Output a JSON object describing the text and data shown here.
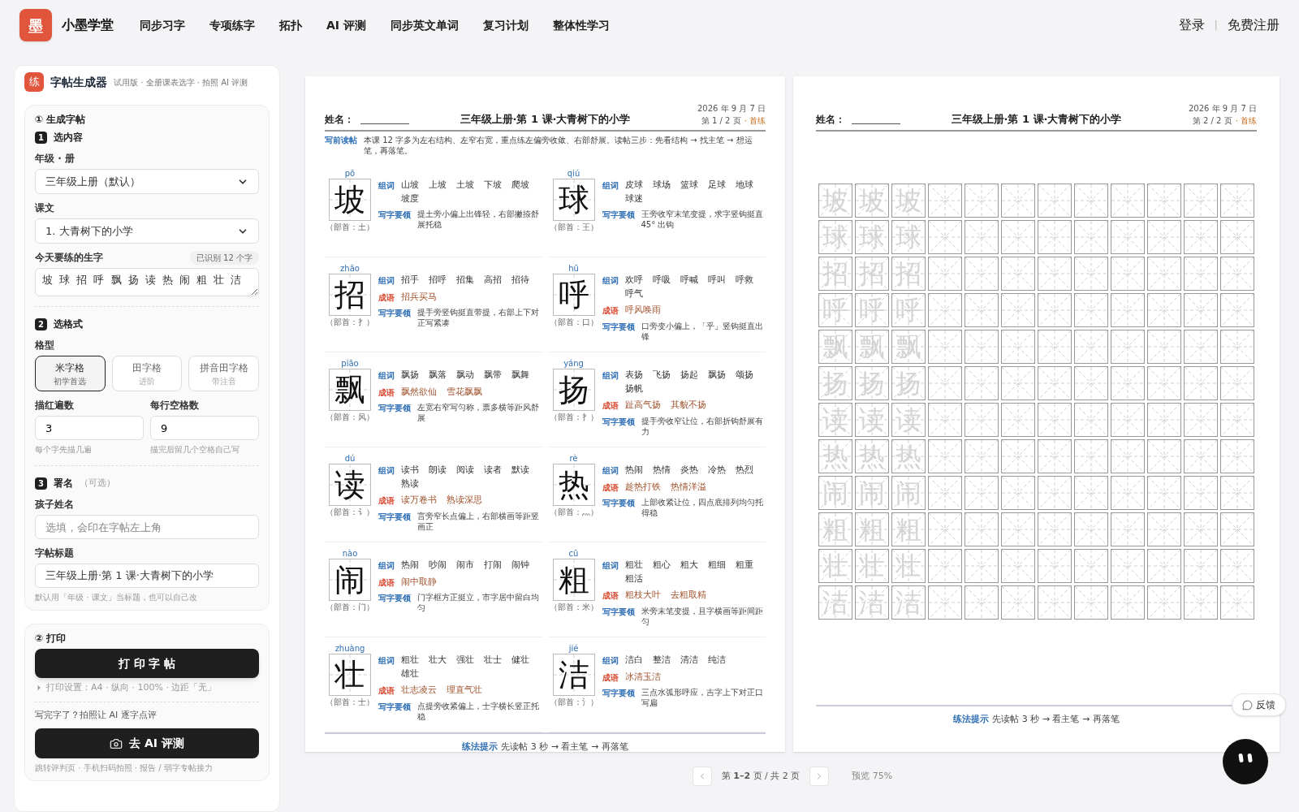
{
  "header": {
    "logo": "墨",
    "brand": "小墨学堂",
    "nav": [
      "同步习字",
      "专项练字",
      "拓扑",
      "AI 评测",
      "同步英文单词",
      "复习计划",
      "整体性学习"
    ],
    "login": "登录",
    "separator": "|",
    "register": "免费注册"
  },
  "sidebar": {
    "logo": "练",
    "title": "字帖生成器",
    "subtitle": "试用版 · 全册课表选字 · 拍照 AI 评测",
    "generate": {
      "heading": "① 生成字帖",
      "step1": {
        "number": "1",
        "title": "选内容",
        "grade_label": "年级 · 册",
        "grade_value": "三年级上册（默认）",
        "lesson_label": "课文",
        "lesson_value": "1. 大青树下的小学",
        "chars_label": "今天要练的生字",
        "chars_count": "已识别 12 个字",
        "chars_value": "坡 球 招 呼 飘 扬 读 热 闹 粗 壮 洁"
      },
      "step2": {
        "number": "2",
        "title": "选格式",
        "type_label": "格型",
        "types": [
          {
            "name": "米字格",
            "hint": "初学首选",
            "selected": true
          },
          {
            "name": "田字格",
            "hint": "进阶",
            "selected": false
          },
          {
            "name": "拼音田字格",
            "hint": "带注音",
            "selected": false
          }
        ],
        "trace_label": "描红遍数",
        "trace_value": "3",
        "trace_hint": "每个字先描几遍",
        "blank_label": "每行空格数",
        "blank_value": "9",
        "blank_hint": "描完后留几个空格自己写"
      },
      "step3": {
        "number": "3",
        "title": "署名",
        "optional": "（可选）",
        "name_label": "孩子姓名",
        "name_placeholder": "选填，会印在字帖左上角",
        "title_label": "字帖标题",
        "title_value": "三年级上册·第 1 课·大青树下的小学",
        "title_hint": "默认用「年级 · 课文」当标题，也可以自己改"
      }
    },
    "print": {
      "heading": "② 打印",
      "print_button": "打 印 字 帖",
      "settings": "打印设置：A4 · 纵向 · 100% · 边距「无」",
      "ai_prompt": "写完字了？拍照让 AI 逐字点评",
      "ai_button": "去 AI 评测",
      "ai_hint": "跳转评判页 · 手机扫码拍照 · 报告 / 弱字专帖接力"
    }
  },
  "pages": [
    {
      "name_label": "姓名：",
      "title": "三年级上册·第 1 课·大青树下的小学",
      "date": "2026 年 9 月 7 日",
      "page_no": "第 1 / 2 页",
      "mark": "· 首练",
      "intro_label": "写前读帖",
      "intro": "本课 12 字多为左右结构、左窄右宽，重点练左偏旁收敛、右部舒展。读帖三步：先看结构 → 找主笔 → 想运笔，再落笔。",
      "entries": [
        {
          "pinyin": "pō",
          "char": "坡",
          "radical": "（部首：土）",
          "lines": [
            {
              "kind": "words",
              "label": "组词",
              "items": [
                "山坡",
                "上坡",
                "土坡",
                "下坡",
                "爬坡",
                "坡度"
              ]
            },
            {
              "kind": "tip",
              "label": "写字要领",
              "text": "提土旁小偏上出锋轻，右部撇捺舒展托稳"
            }
          ]
        },
        {
          "pinyin": "qiú",
          "char": "球",
          "radical": "（部首：王）",
          "lines": [
            {
              "kind": "words",
              "label": "组词",
              "items": [
                "皮球",
                "球场",
                "篮球",
                "足球",
                "地球",
                "球迷"
              ]
            },
            {
              "kind": "tip",
              "label": "写字要领",
              "text": "王旁收窄末笔变提，求字竖钩挺直 45° 出钩"
            }
          ]
        },
        {
          "pinyin": "zhāo",
          "char": "招",
          "radical": "（部首：扌）",
          "lines": [
            {
              "kind": "words",
              "label": "组词",
              "items": [
                "招手",
                "招呼",
                "招集",
                "高招",
                "招待"
              ]
            },
            {
              "kind": "idioms",
              "label": "成语",
              "items": [
                "招兵买马"
              ]
            },
            {
              "kind": "tip",
              "label": "写字要领",
              "text": "提手旁竖钩挺直带提，右部上下对正写紧凑"
            }
          ]
        },
        {
          "pinyin": "hū",
          "char": "呼",
          "radical": "（部首：口）",
          "lines": [
            {
              "kind": "words",
              "label": "组词",
              "items": [
                "欢呼",
                "呼吸",
                "呼喊",
                "呼叫",
                "呼救",
                "呼气"
              ]
            },
            {
              "kind": "idioms",
              "label": "成语",
              "items": [
                "呼风唤雨"
              ]
            },
            {
              "kind": "tip",
              "label": "写字要领",
              "text": "口旁变小偏上，「乎」竖钩挺直出锋"
            }
          ]
        },
        {
          "pinyin": "piāo",
          "char": "飘",
          "radical": "（部首：风）",
          "lines": [
            {
              "kind": "words",
              "label": "组词",
              "items": [
                "飘扬",
                "飘落",
                "飘动",
                "飘带",
                "飘舞"
              ]
            },
            {
              "kind": "idioms",
              "label": "成语",
              "items": [
                "飘然欲仙",
                "雪花飘飘"
              ]
            },
            {
              "kind": "tip",
              "label": "写字要领",
              "text": "左宽右窄写匀称，票多横等距风舒展"
            }
          ]
        },
        {
          "pinyin": "yáng",
          "char": "扬",
          "radical": "（部首：扌）",
          "lines": [
            {
              "kind": "words",
              "label": "组词",
              "items": [
                "表扬",
                "飞扬",
                "扬起",
                "飘扬",
                "颂扬",
                "扬帆"
              ]
            },
            {
              "kind": "idioms",
              "label": "成语",
              "items": [
                "趾高气扬",
                "其貌不扬"
              ]
            },
            {
              "kind": "tip",
              "label": "写字要领",
              "text": "提手旁收窄让位，右部折钩舒展有力"
            }
          ]
        },
        {
          "pinyin": "dú",
          "char": "读",
          "radical": "（部首：讠）",
          "lines": [
            {
              "kind": "words",
              "label": "组词",
              "items": [
                "读书",
                "朗读",
                "阅读",
                "读者",
                "默读",
                "熟读"
              ]
            },
            {
              "kind": "idioms",
              "label": "成语",
              "items": [
                "读万卷书",
                "熟读深思"
              ]
            },
            {
              "kind": "tip",
              "label": "写字要领",
              "text": "言旁窄长点偏上，右部横画等距竖画正"
            }
          ]
        },
        {
          "pinyin": "rè",
          "char": "热",
          "radical": "（部首：灬）",
          "lines": [
            {
              "kind": "words",
              "label": "组词",
              "items": [
                "热闹",
                "热情",
                "炎热",
                "冷热",
                "热烈"
              ]
            },
            {
              "kind": "idioms",
              "label": "成语",
              "items": [
                "趁热打铁",
                "热情洋溢"
              ]
            },
            {
              "kind": "tip",
              "label": "写字要领",
              "text": "上部收紧让位，四点底排列均匀托得稳"
            }
          ]
        },
        {
          "pinyin": "nào",
          "char": "闹",
          "radical": "（部首：门）",
          "lines": [
            {
              "kind": "words",
              "label": "组词",
              "items": [
                "热闹",
                "吵闹",
                "闹市",
                "打闹",
                "闹钟"
              ]
            },
            {
              "kind": "idioms",
              "label": "成语",
              "items": [
                "闹中取静"
              ]
            },
            {
              "kind": "tip",
              "label": "写字要领",
              "text": "门字框方正挺立，市字居中留白均匀"
            }
          ]
        },
        {
          "pinyin": "cū",
          "char": "粗",
          "radical": "（部首：米）",
          "lines": [
            {
              "kind": "words",
              "label": "组词",
              "items": [
                "粗壮",
                "粗心",
                "粗大",
                "粗细",
                "粗重",
                "粗活"
              ]
            },
            {
              "kind": "idioms",
              "label": "成语",
              "items": [
                "粗枝大叶",
                "去粗取精"
              ]
            },
            {
              "kind": "tip",
              "label": "写字要领",
              "text": "米旁末笔变提，且字横画等距间距匀"
            }
          ]
        },
        {
          "pinyin": "zhuàng",
          "char": "壮",
          "radical": "（部首：士）",
          "lines": [
            {
              "kind": "words",
              "label": "组词",
              "items": [
                "粗壮",
                "壮大",
                "强壮",
                "壮士",
                "健壮",
                "雄壮"
              ]
            },
            {
              "kind": "idioms",
              "label": "成语",
              "items": [
                "壮志凌云",
                "理直气壮"
              ]
            },
            {
              "kind": "tip",
              "label": "写字要领",
              "text": "点提旁收紧偏上，士字横长竖正托稳"
            }
          ]
        },
        {
          "pinyin": "jié",
          "char": "洁",
          "radical": "（部首：氵）",
          "lines": [
            {
              "kind": "words",
              "label": "组词",
              "items": [
                "洁白",
                "整洁",
                "清洁",
                "纯洁"
              ]
            },
            {
              "kind": "idioms",
              "label": "成语",
              "items": [
                "冰清玉洁"
              ]
            },
            {
              "kind": "tip",
              "label": "写字要领",
              "text": "三点水弧形呼应，吉字上下对正口写扁"
            }
          ]
        }
      ],
      "footer_label": "练法提示",
      "footer": "先读帖 3 秒 → 看主笔 → 再落笔"
    },
    {
      "name_label": "姓名：",
      "title": "三年级上册·第 1 课·大青树下的小学",
      "date": "2026 年 9 月 7 日",
      "page_no": "第 2 / 2 页",
      "mark": "· 首练",
      "grid_rows": [
        [
          "坡",
          "坡",
          "坡"
        ],
        [
          "球",
          "球",
          "球"
        ],
        [
          "招",
          "招",
          "招"
        ],
        [
          "呼",
          "呼",
          "呼"
        ],
        [
          "飘",
          "飘",
          "飘"
        ],
        [
          "扬",
          "扬",
          "扬"
        ],
        [
          "读",
          "读",
          "读"
        ],
        [
          "热",
          "热",
          "热"
        ],
        [
          "闹",
          "闹",
          "闹"
        ],
        [
          "粗",
          "粗",
          "粗"
        ],
        [
          "壮",
          "壮",
          "壮"
        ],
        [
          "洁",
          "洁",
          "洁"
        ]
      ],
      "footer_label": "练法提示",
      "footer": "先读帖 3 秒 → 看主笔 → 再落笔"
    }
  ],
  "pager": {
    "text": "第 **1–2** 页 / 共 2 页",
    "zoom": "预览 75%"
  },
  "feedback": "反馈"
}
